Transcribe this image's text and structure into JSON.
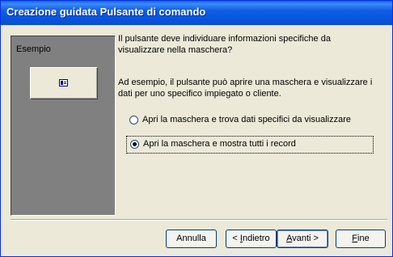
{
  "window": {
    "title": "Creazione guidata Pulsante di comando"
  },
  "example": {
    "label": "Esempio",
    "button_icon": "form-icon"
  },
  "question": "Il pulsante deve individuare informazioni specifiche da visualizzare nella maschera?",
  "example_text": "Ad esempio, il pulsante può aprire una maschera e visualizzare i dati per uno specifico impiegato o cliente.",
  "options": [
    {
      "label": "Apri  la maschera e trova dati specifici da visualizzare",
      "selected": false
    },
    {
      "label": "Apri la maschera e mostra tutti i record",
      "selected": true
    }
  ],
  "buttons": {
    "annulla": "Annulla",
    "indietro_prefix": "< ",
    "indietro_accel": "I",
    "indietro_rest": "ndietro",
    "avanti_accel": "A",
    "avanti_rest": "vanti >",
    "fine_accel": "F",
    "fine_rest": "ine"
  }
}
